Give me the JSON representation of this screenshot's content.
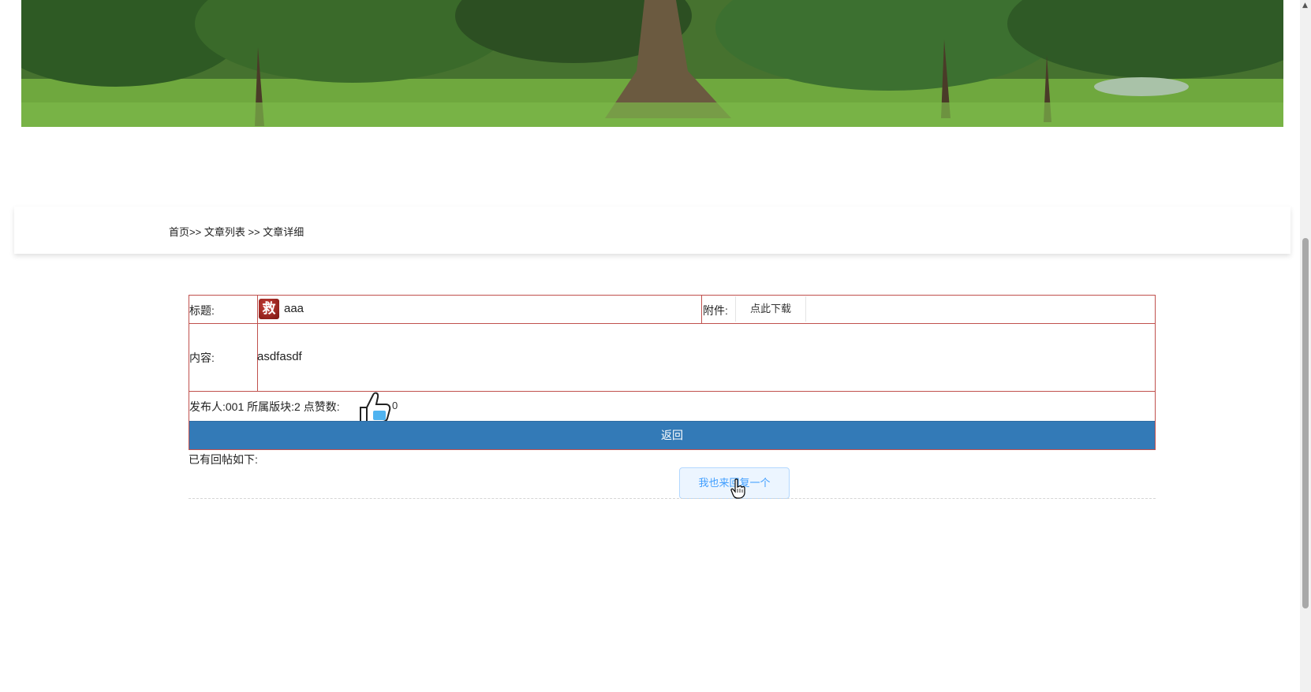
{
  "breadcrumb": {
    "home": "首页>>",
    "list": "文章列表",
    "separator": ">>",
    "detail": "文章详细"
  },
  "article": {
    "title_label": "标题:",
    "badge_char": "救",
    "title": "aaa",
    "attachment_label": "附件:",
    "download_label": "点此下载",
    "content_label": "内容:",
    "content": "asdfasdf",
    "meta_text": "发布人:001 所属版块:2 点赞数:",
    "like_count": "0",
    "back_label": "返回"
  },
  "replies": {
    "label": "已有回帖如下:",
    "reply_button": "我也来回复一个"
  },
  "colors": {
    "table_border": "#c0504d",
    "back_button": "#337ab7",
    "reply_button_text": "#409eff"
  }
}
